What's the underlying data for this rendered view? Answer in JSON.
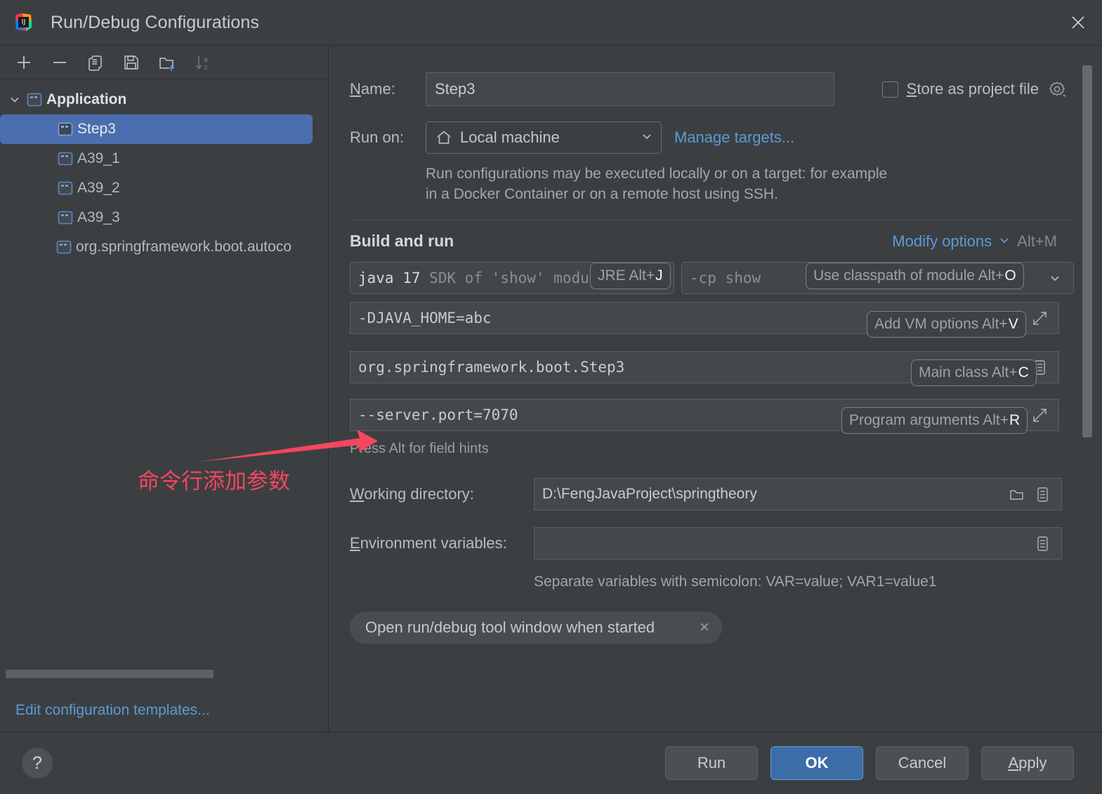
{
  "window": {
    "title": "Run/Debug Configurations",
    "logo_icon": "intellij-idea-logo",
    "close_icon": "close-icon"
  },
  "sidebar": {
    "toolbar": [
      {
        "name": "add",
        "icon": "plus-icon"
      },
      {
        "name": "remove",
        "icon": "minus-icon"
      },
      {
        "name": "copy",
        "icon": "copy-icon"
      },
      {
        "name": "save",
        "icon": "floppy-save-icon"
      },
      {
        "name": "new-folder",
        "icon": "folder-plus-icon"
      },
      {
        "name": "sort",
        "icon": "sort-az-icon"
      }
    ],
    "tree": [
      {
        "label": "Application",
        "level": 0,
        "selected": false,
        "expanded": true
      },
      {
        "label": "Step3",
        "level": 1,
        "selected": true
      },
      {
        "label": "A39_1",
        "level": 1,
        "selected": false
      },
      {
        "label": "A39_2",
        "level": 1,
        "selected": false
      },
      {
        "label": "A39_3",
        "level": 1,
        "selected": false
      },
      {
        "label": "org.springframework.boot.autoco",
        "level": 1,
        "selected": false
      }
    ],
    "templates_link": "Edit configuration templates..."
  },
  "form": {
    "name_label": "Name:",
    "name_value": "Step3",
    "store_as_project_file": "Store as project file",
    "store_checked": false,
    "store_gear_icon": "gear-icon",
    "run_on_label": "Run on:",
    "run_on_value": "Local machine",
    "run_on_icon": "home-icon",
    "manage_targets": "Manage targets...",
    "run_on_description": "Run configurations may be executed locally or on a target: for example in a Docker Container or on a remote host using SSH.",
    "build_and_run_title": "Build and run",
    "modify_options": "Modify options",
    "modify_options_shortcut": "Alt+M",
    "jre_value_bright": "java 17",
    "jre_value_dim": "SDK of 'show' module",
    "classpath_value": "-cp show",
    "vm_options_value": "-DJAVA_HOME=abc",
    "main_class_value": "org.springframework.boot.Step3",
    "program_arguments_value": "--server.port=7070",
    "field_hints": "Press Alt for field hints",
    "working_directory_label": "Working directory:",
    "working_directory_value": "D:\\FengJavaProject\\springtheory",
    "environment_variables_label": "Environment variables:",
    "environment_variables_value": "",
    "environment_hint": "Separate variables with semicolon: VAR=value; VAR1=value1",
    "chip_label": "Open run/debug tool window when started",
    "chip_close_icon": "close-icon"
  },
  "hints": [
    {
      "name": "jre-hint",
      "text": "JRE Alt+",
      "key": "J"
    },
    {
      "name": "classpath-module-hint",
      "text": "Use classpath of module Alt+",
      "key": "O"
    },
    {
      "name": "vm-options-hint",
      "text": "Add VM options Alt+",
      "key": "V"
    },
    {
      "name": "main-class-hint",
      "text": "Main class Alt+",
      "key": "C"
    },
    {
      "name": "program-arguments-hint",
      "text": "Program arguments Alt+",
      "key": "R"
    }
  ],
  "annotation": {
    "text": "命令行添加参数",
    "color": "#f4465e"
  },
  "footer": {
    "help_label": "?",
    "buttons": [
      {
        "name": "run",
        "label": "Run",
        "primary": false,
        "mnemonic": ""
      },
      {
        "name": "ok",
        "label": "OK",
        "primary": true,
        "mnemonic": ""
      },
      {
        "name": "cancel",
        "label": "Cancel",
        "primary": false,
        "mnemonic": ""
      },
      {
        "name": "apply",
        "label": "Apply",
        "primary": false,
        "mnemonic": "A"
      }
    ]
  },
  "colors": {
    "background": "#3c3f41",
    "selection_blue": "#4b6eaf",
    "link_blue": "#5a9bd8",
    "primary_button": "#3b6ea8",
    "annotation_red": "#f4465e"
  }
}
